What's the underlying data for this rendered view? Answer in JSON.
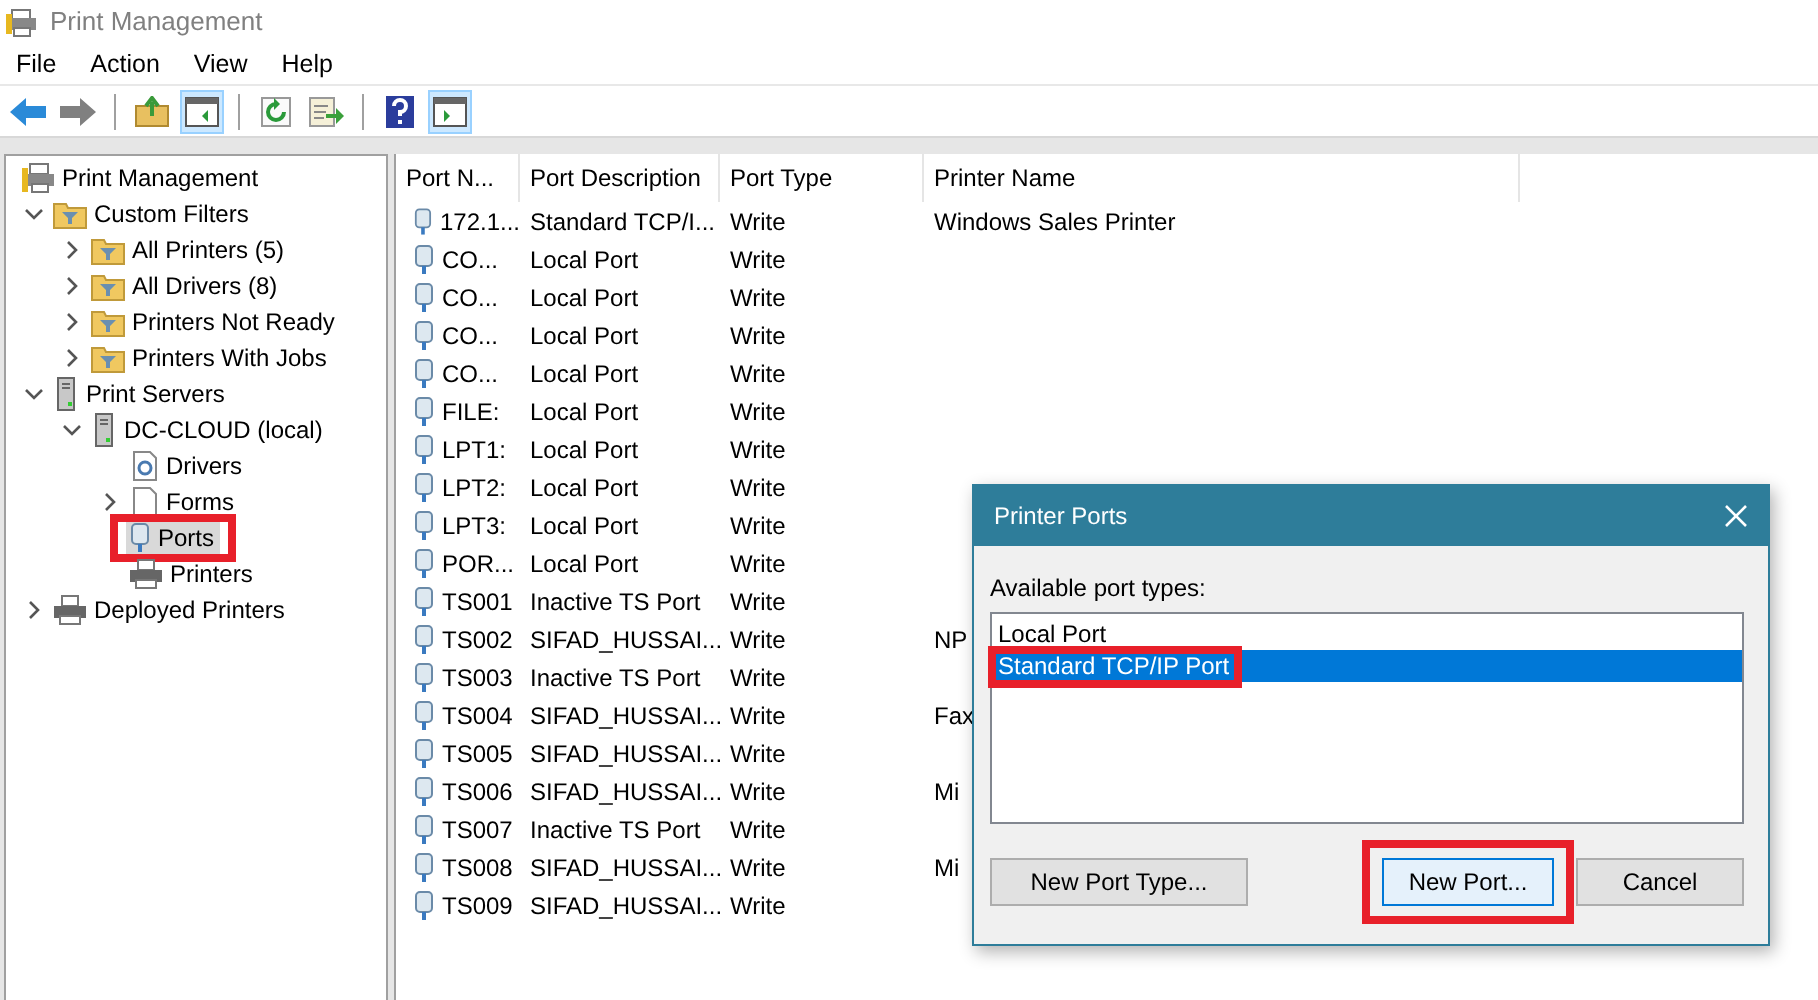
{
  "window": {
    "title": "Print Management"
  },
  "menu": [
    "File",
    "Action",
    "View",
    "Help"
  ],
  "toolbar": [
    {
      "kind": "back",
      "pressed": false
    },
    {
      "kind": "forward",
      "pressed": false
    },
    {
      "kind": "sep"
    },
    {
      "kind": "up",
      "pressed": false
    },
    {
      "kind": "tree-toggle",
      "pressed": true
    },
    {
      "kind": "sep"
    },
    {
      "kind": "refresh",
      "pressed": false
    },
    {
      "kind": "export",
      "pressed": false
    },
    {
      "kind": "sep"
    },
    {
      "kind": "help",
      "pressed": false
    },
    {
      "kind": "action-toggle",
      "pressed": true
    }
  ],
  "tree": [
    {
      "label": "Print Management",
      "kind": "management",
      "selected": false,
      "highlighted": false,
      "children": [
        {
          "label": "Custom Filters",
          "kind": "filter",
          "selected": false,
          "highlighted": false,
          "expanded": true,
          "children": [
            {
              "label": "All Printers (5)",
              "kind": "filter",
              "selected": false,
              "highlighted": false,
              "expanded": false
            },
            {
              "label": "All Drivers (8)",
              "kind": "filter",
              "selected": false,
              "highlighted": false,
              "expanded": false
            },
            {
              "label": "Printers Not Ready",
              "kind": "filter",
              "selected": false,
              "highlighted": false,
              "expanded": false
            },
            {
              "label": "Printers With Jobs",
              "kind": "filter",
              "selected": false,
              "highlighted": false,
              "expanded": false
            }
          ]
        },
        {
          "label": "Print Servers",
          "kind": "server",
          "selected": false,
          "highlighted": false,
          "expanded": true,
          "children": [
            {
              "label": "DC-CLOUD (local)",
              "kind": "server",
              "selected": false,
              "highlighted": false,
              "expanded": true,
              "children": [
                {
                  "label": "Drivers",
                  "kind": "drivers",
                  "selected": false,
                  "highlighted": false
                },
                {
                  "label": "Forms",
                  "kind": "forms",
                  "selected": false,
                  "highlighted": false,
                  "expanded": false
                },
                {
                  "label": "Ports",
                  "kind": "port",
                  "selected": true,
                  "highlighted": true
                },
                {
                  "label": "Printers",
                  "kind": "printer",
                  "selected": false,
                  "highlighted": false
                }
              ]
            }
          ]
        },
        {
          "label": "Deployed Printers",
          "kind": "printer",
          "selected": false,
          "highlighted": false,
          "expanded": false
        }
      ]
    }
  ],
  "table": {
    "columns": [
      "Port N...",
      "Port Description",
      "Port Type",
      "Printer Name"
    ],
    "rows": [
      {
        "name": "172.1...",
        "description": "Standard TCP/I...",
        "type": "Write",
        "printer": "Windows Sales Printer"
      },
      {
        "name": "CO...",
        "description": "Local Port",
        "type": "Write"
      },
      {
        "name": "CO...",
        "description": "Local Port",
        "type": "Write"
      },
      {
        "name": "CO...",
        "description": "Local Port",
        "type": "Write"
      },
      {
        "name": "CO...",
        "description": "Local Port",
        "type": "Write"
      },
      {
        "name": "FILE:",
        "description": "Local Port",
        "type": "Write"
      },
      {
        "name": "LPT1:",
        "description": "Local Port",
        "type": "Write"
      },
      {
        "name": "LPT2:",
        "description": "Local Port",
        "type": "Write"
      },
      {
        "name": "LPT3:",
        "description": "Local Port",
        "type": "Write"
      },
      {
        "name": "POR...",
        "description": "Local Port",
        "type": "Write"
      },
      {
        "name": "TS001",
        "description": "Inactive TS Port",
        "type": "Write"
      },
      {
        "name": "TS002",
        "description": "SIFAD_HUSSAI...",
        "type": "Write",
        "printer": "NP"
      },
      {
        "name": "TS003",
        "description": "Inactive TS Port",
        "type": "Write"
      },
      {
        "name": "TS004",
        "description": "SIFAD_HUSSAI...",
        "type": "Write",
        "printer": "Fax"
      },
      {
        "name": "TS005",
        "description": "SIFAD_HUSSAI...",
        "type": "Write"
      },
      {
        "name": "TS006",
        "description": "SIFAD_HUSSAI...",
        "type": "Write",
        "printer": "Mi"
      },
      {
        "name": "TS007",
        "description": "Inactive TS Port",
        "type": "Write"
      },
      {
        "name": "TS008",
        "description": "SIFAD_HUSSAI...",
        "type": "Write",
        "printer": "Mi"
      },
      {
        "name": "TS009",
        "description": "SIFAD_HUSSAI...",
        "type": "Write"
      }
    ]
  },
  "dialog": {
    "title": "Printer Ports",
    "label": "Available port types:",
    "port_types": [
      {
        "label": "Local Port",
        "selected": false,
        "highlighted": false
      },
      {
        "label": "Standard TCP/IP Port",
        "selected": true,
        "highlighted": true
      }
    ],
    "buttons": [
      {
        "label": "New Port Type...",
        "default": false,
        "highlighted": false
      },
      {
        "label": "New Port...",
        "default": true,
        "highlighted": true
      },
      {
        "label": "Cancel",
        "default": false,
        "highlighted": false
      }
    ]
  }
}
